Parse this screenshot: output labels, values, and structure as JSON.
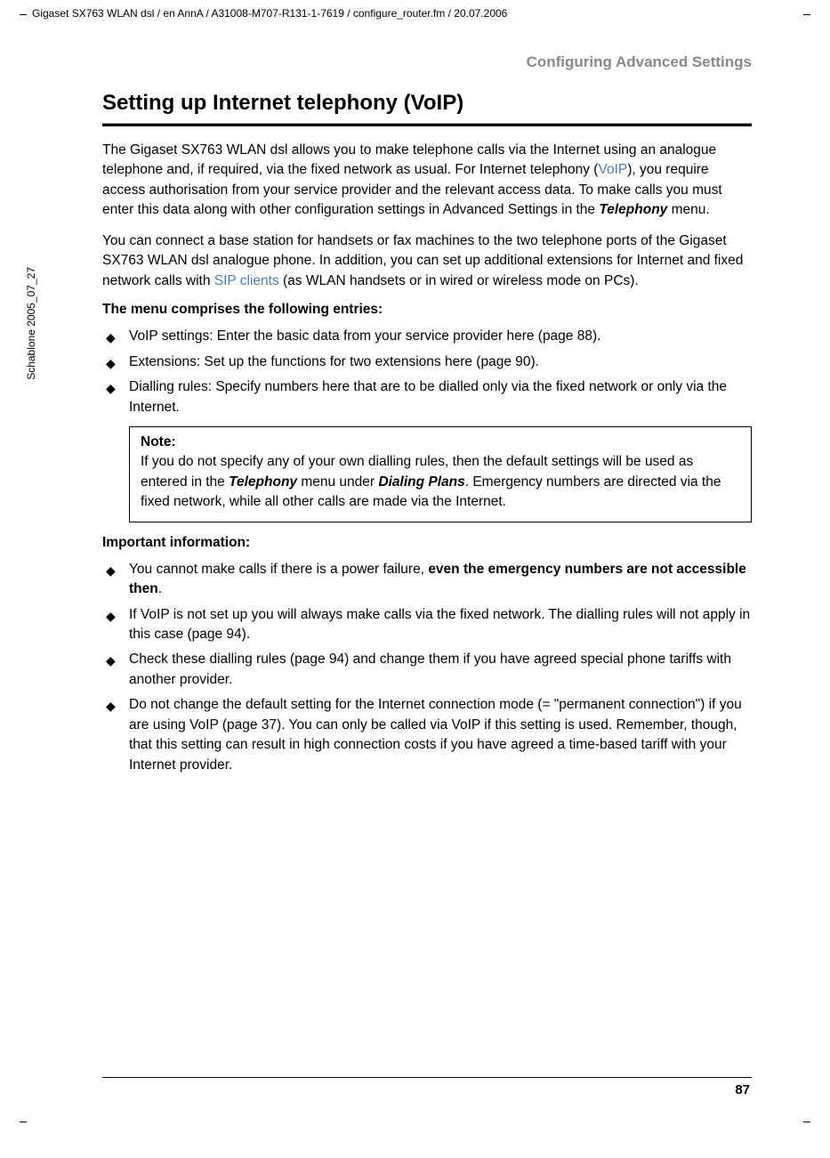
{
  "header": {
    "path": "Gigaset SX763 WLAN dsl / en AnnA / A31008-M707-R131-1-7619 / configure_router.fm / 20.07.2006"
  },
  "sidebar": {
    "text": "Schablone 2005_07_27"
  },
  "section_header": "Configuring Advanced Settings",
  "title": "Setting up Internet telephony (VoIP)",
  "para1": {
    "t1": "The Gigaset SX763 WLAN dsl allows you to make telephone calls via the Internet using an analogue telephone and, if required, via the fixed network as usual. For Internet telephony (",
    "link": "VoIP",
    "t2": "), you require access authorisation from your service provider and the relevant access data. To make calls you must enter this data along with other configuration settings in Advanced Settings in the ",
    "emph": "Telephony",
    "t3": " menu."
  },
  "para2": {
    "t1": "You can connect a base station for handsets or fax machines to the two telephone ports of the Gigaset SX763 WLAN dsl analogue phone. In addition, you can set up additional extensions for Internet and fixed network calls with ",
    "link": "SIP clients",
    "t2": " (as WLAN handsets or in wired or wireless mode on PCs)."
  },
  "subheading1": "The menu comprises the following entries:",
  "menu_bullets": {
    "b1": "VoIP settings: Enter the basic data from your service provider here (page 88).",
    "b2": "Extensions: Set up the functions for two extensions here (page 90).",
    "b3": "Dialling rules: Specify numbers here that are to be dialled only via the fixed network or only via the Internet."
  },
  "note": {
    "title": "Note:",
    "t1": "If you do not specify any of your own dialling rules, then the default settings will be used as entered in the ",
    "emph1": "Telephony",
    "t2": " menu under ",
    "emph2": "Dialing Plans",
    "t3": ". Emergency numbers are directed via the fixed network, while all other calls are made via the Internet."
  },
  "subheading2": "Important information:",
  "info_bullets": {
    "b1a": "You cannot make calls if there is a power failure, ",
    "b1b": "even the emergency numbers are not accessible then",
    "b1c": ".",
    "b2": "If VoIP is not set up you will always make calls via the fixed network. The dialling rules will not apply in this case (page 94).",
    "b3": "Check these dialling rules (page 94) and change them if you have agreed special phone tariffs with another provider.",
    "b4": "Do not change the default setting for the Internet connection mode (= \"permanent connection\") if you are using VoIP (page 37). You can only be called via VoIP if this setting is used. Remember, though, that this setting can result in high connection costs if you have agreed a time-based tariff with your Internet provider."
  },
  "page_number": "87"
}
